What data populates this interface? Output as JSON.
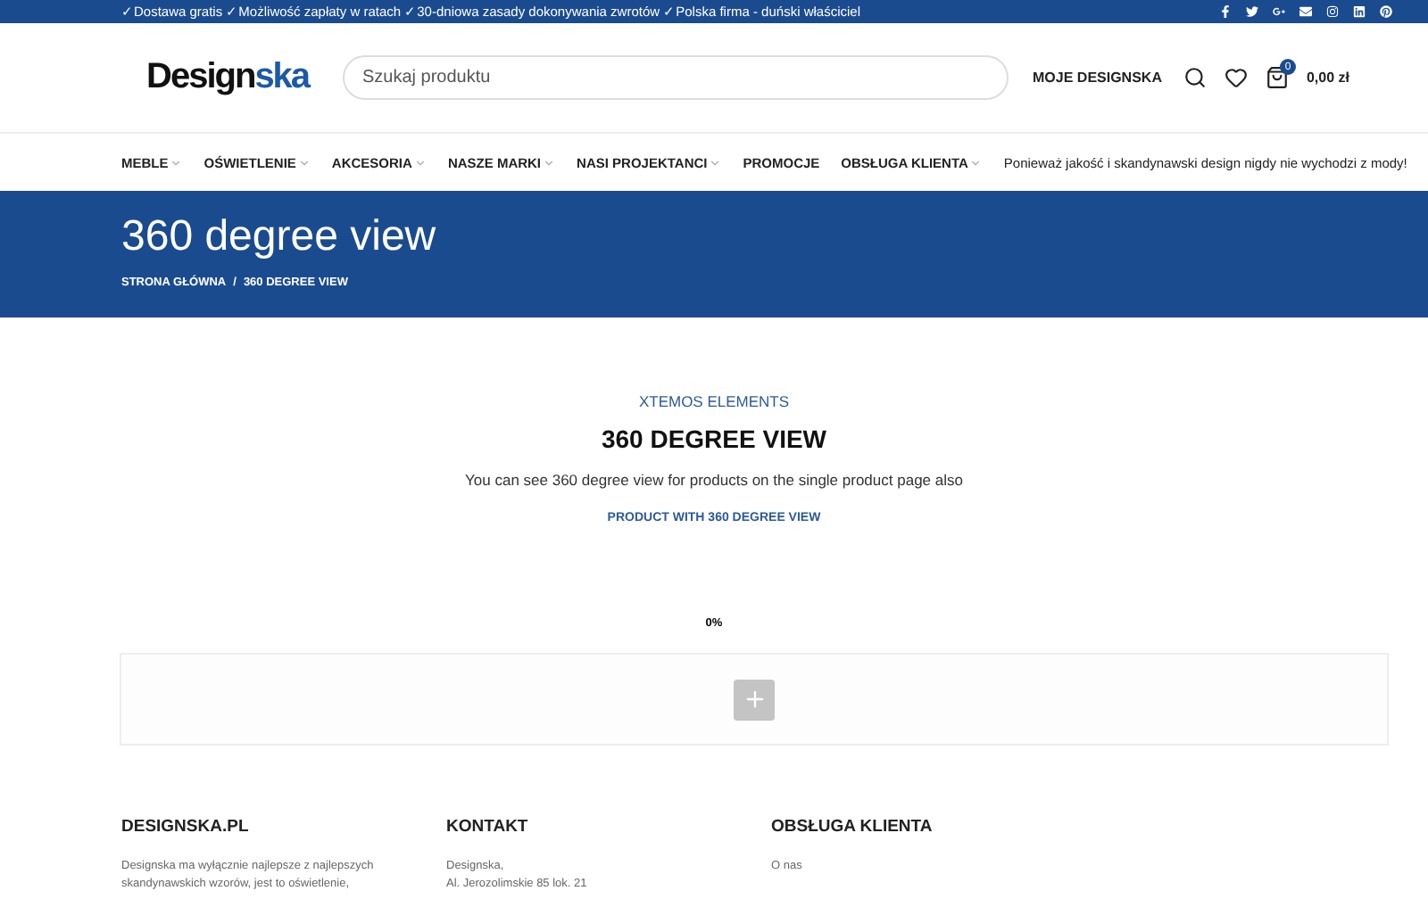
{
  "top_bar": {
    "text": "✓Dostawa gratis ✓Możliwość zapłaty w ratach ✓30-dniowa zasady dokonywania zwrotów ✓Polska firma - duński właściciel"
  },
  "header": {
    "logo": {
      "dark": "Design",
      "accent": "ska"
    },
    "search": {
      "placeholder": "Szukaj produktu"
    },
    "account": "MOJE DESIGNSKA",
    "cart": {
      "count": "0",
      "total": "0,00 zł"
    }
  },
  "nav": {
    "items": [
      {
        "label": "MEBLE",
        "dropdown": true
      },
      {
        "label": "OŚWIETLENIE",
        "dropdown": true
      },
      {
        "label": "AKCESORIA",
        "dropdown": true
      },
      {
        "label": "NASZE MARKI",
        "dropdown": true
      },
      {
        "label": "NASI PROJEKTANCI",
        "dropdown": true
      },
      {
        "label": "PROMOCJE",
        "dropdown": false
      },
      {
        "label": "OBSŁUGA KLIENTA",
        "dropdown": true
      }
    ],
    "tagline": "Ponieważ jakość i skandynawski design nigdy nie wychodzi z mody!"
  },
  "banner": {
    "title": "360 degree view",
    "breadcrumb": [
      "STRONA GŁÓWNA",
      "360 DEGREE VIEW"
    ],
    "separator": "/"
  },
  "section": {
    "subtitle": "XTEMOS ELEMENTS",
    "title": "360 DEGREE VIEW",
    "text": "You can see 360 degree view for products on the single product page also",
    "link": "PRODUCT WITH 360 DEGREE VIEW"
  },
  "viewer": {
    "progress": "0%"
  },
  "footer": [
    {
      "title": "DESIGNSKA.PL",
      "lines": [
        "Designska ma wyłącznie najlepsze z najlepszych",
        "skandynawskich wzorów, jest to oświetlenie,"
      ]
    },
    {
      "title": "KONTAKT",
      "lines": [
        "Designska,",
        "Al. Jerozolimskie 85 lok. 21"
      ]
    },
    {
      "title": "OBSŁUGA KLIENTA",
      "lines": [
        "O nas"
      ]
    }
  ]
}
